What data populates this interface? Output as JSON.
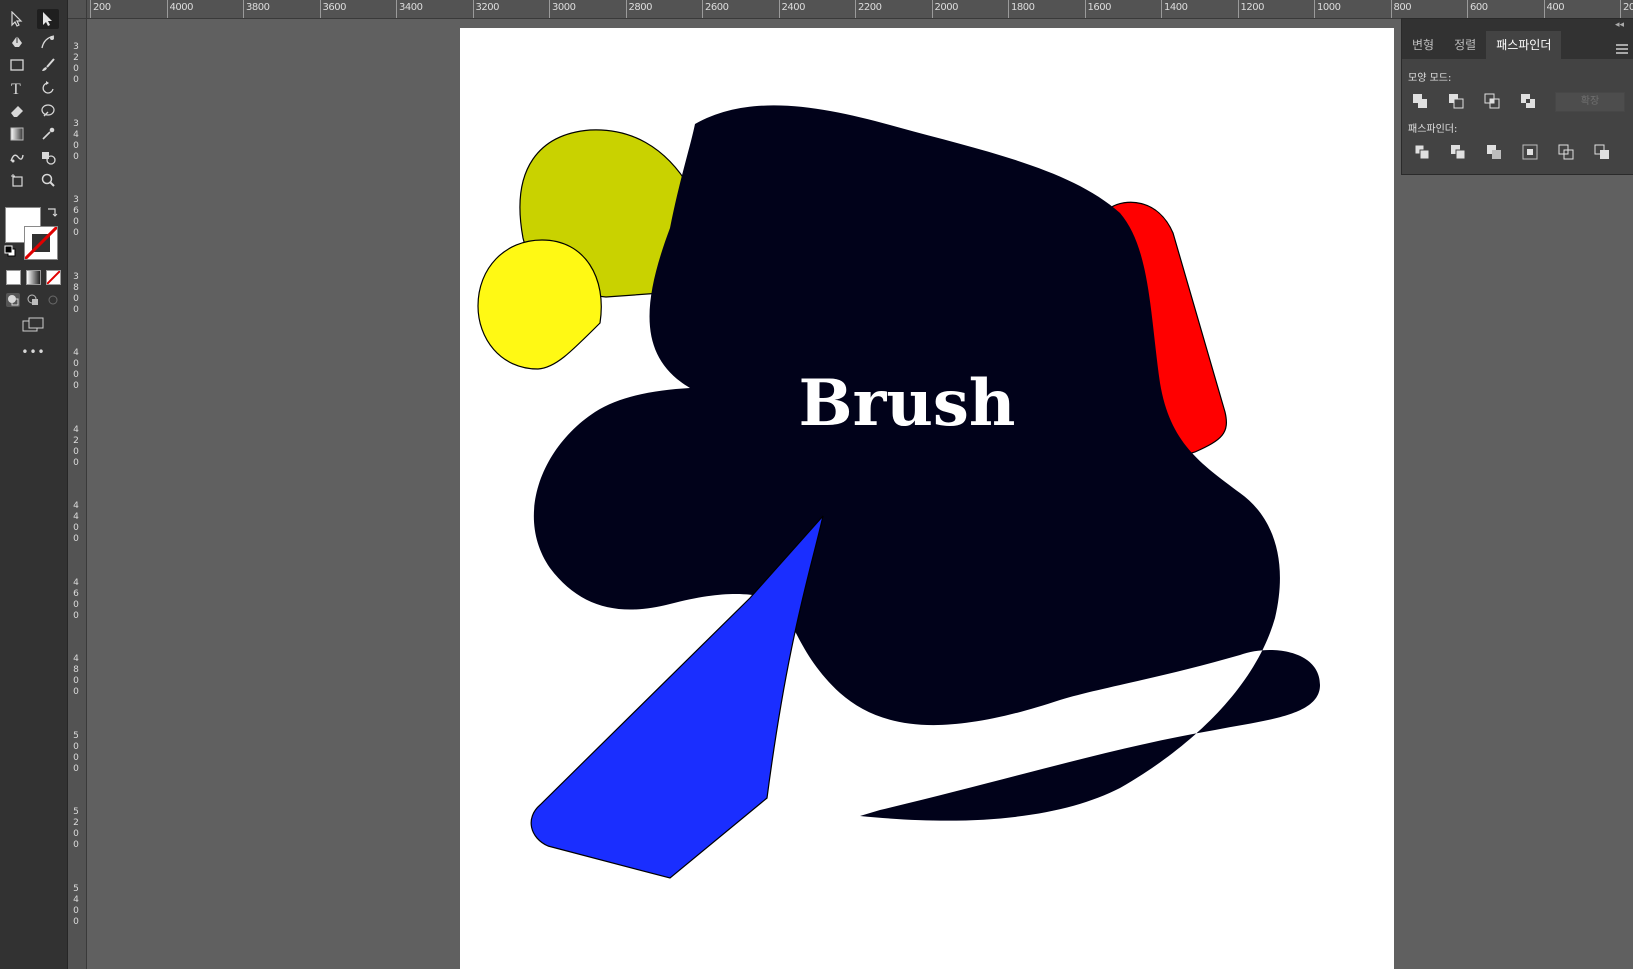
{
  "toolbar": {
    "tools": [
      {
        "name": "selection-tool-icon",
        "selected": false
      },
      {
        "name": "direct-selection-tool-icon",
        "selected": true
      },
      {
        "name": "pen-tool-icon"
      },
      {
        "name": "curvature-tool-icon"
      },
      {
        "name": "rectangle-tool-icon"
      },
      {
        "name": "paintbrush-tool-icon"
      },
      {
        "name": "type-tool-icon"
      },
      {
        "name": "rotate-tool-icon"
      },
      {
        "name": "eraser-tool-icon"
      },
      {
        "name": "warp-tool-icon"
      },
      {
        "name": "gradient-tool-icon"
      },
      {
        "name": "eyedropper-tool-icon"
      },
      {
        "name": "puppet-warp-tool-icon"
      },
      {
        "name": "shape-builder-tool-icon"
      },
      {
        "name": "artboard-tool-icon"
      },
      {
        "name": "zoom-tool-icon"
      }
    ],
    "more_label": "•••",
    "fill_color": "#ffffff",
    "stroke_none": true
  },
  "rulers": {
    "horizontal": [
      "200",
      "4000",
      "3800",
      "3600",
      "3400",
      "3200",
      "3000",
      "2800",
      "2600",
      "2400",
      "2200",
      "2000",
      "1800",
      "1600",
      "1400",
      "1200",
      "1000",
      "800",
      "600",
      "400",
      "200"
    ],
    "vertical": [
      "3200",
      "3400",
      "3600",
      "3800",
      "4000",
      "4200",
      "4400",
      "4600",
      "4800",
      "5000",
      "5200",
      "5400"
    ]
  },
  "canvas": {
    "artboard_color": "#ffffff",
    "text": "Brush",
    "shapes": {
      "olive_circle": "#c9d200",
      "yellow_circle": "#fff914",
      "black_blob": "#01021a",
      "red_shape": "#ff0000",
      "blue_shape": "#1a2eff"
    }
  },
  "panel": {
    "tabs": [
      {
        "label": "변형",
        "active": false
      },
      {
        "label": "정렬",
        "active": false
      },
      {
        "label": "패스파인더",
        "active": true
      }
    ],
    "shape_modes_label": "모양 모드:",
    "pathfinders_label": "패스파인더:",
    "expand_label": "확장",
    "shape_mode_buttons": [
      "unite-icon",
      "minus-front-icon",
      "intersect-icon",
      "exclude-icon"
    ],
    "pathfinder_buttons": [
      "divide-icon",
      "trim-icon",
      "merge-icon",
      "crop-icon",
      "outline-icon",
      "minus-back-icon"
    ]
  }
}
